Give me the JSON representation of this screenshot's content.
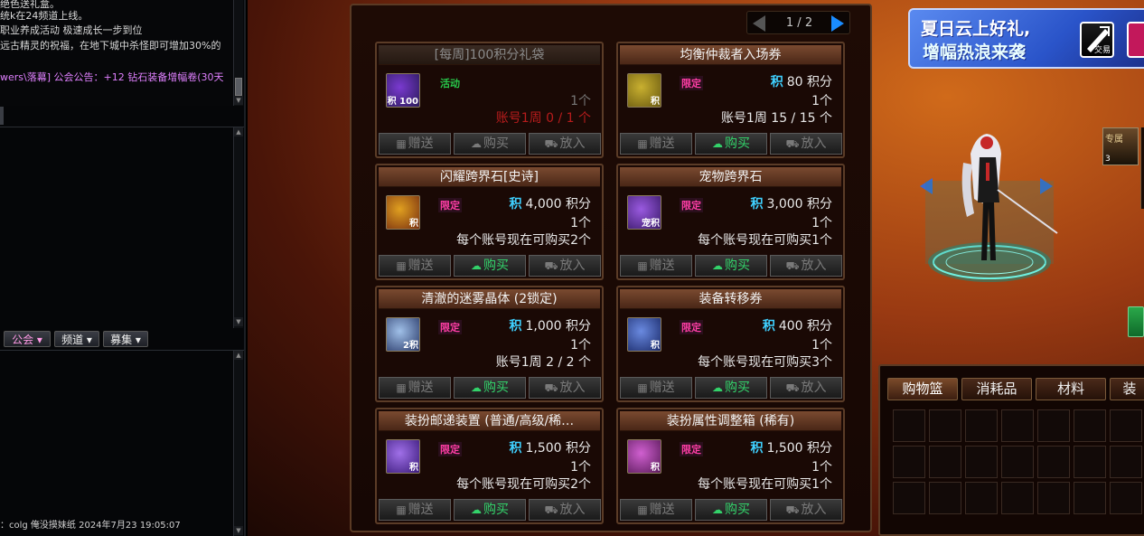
{
  "chat": {
    "top_lines": [
      "绝色送礼盒。",
      "        统k在24频道上线。",
      "职业养成活动 极速成长一步到位",
      "远古精灵的祝福，在地下城中杀怪即可增加30%的"
    ],
    "guild_line": "wers\\落幕] 公会公告：+12 钻石装备增幅卷(30天",
    "tabs": [
      "公会",
      "频道",
      "募集"
    ],
    "last_line": "：colg 俺没摸妹纸 2024年7月23 19:05:07"
  },
  "shop": {
    "pager": "1 / 2",
    "items": [
      {
        "title": "[每周]100积分礼袋",
        "icon": "积\n100",
        "tag": "活动",
        "price": "",
        "qty": "1个",
        "limit": "账号1周 0 / 1 个",
        "buttons": [
          "赠送",
          "购买",
          "放入"
        ]
      },
      {
        "title": "均衡仲裁者入场券",
        "icon": "积",
        "tag": "限定",
        "price": "80 积分",
        "qty": "1个",
        "limit": "账号1周 15 / 15 个",
        "buttons": [
          "赠送",
          "购买",
          "放入"
        ]
      },
      {
        "title": "闪耀跨界石[史诗]",
        "icon": "积",
        "tag": "限定",
        "price": "4,000 积分",
        "qty": "1个",
        "limit": "每个账号现在可购买2个",
        "buttons": [
          "赠送",
          "购买",
          "放入"
        ]
      },
      {
        "title": "宠物跨界石",
        "icon": "宠积",
        "tag": "限定",
        "price": "3,000 积分",
        "qty": "1个",
        "limit": "每个账号现在可购买1个",
        "buttons": [
          "赠送",
          "购买",
          "放入"
        ]
      },
      {
        "title": "清澈的迷雾晶体 (2锁定)",
        "icon": "2积",
        "tag": "限定",
        "price": "1,000 积分",
        "qty": "1个",
        "limit": "账号1周 2 / 2 个",
        "buttons": [
          "赠送",
          "购买",
          "放入"
        ]
      },
      {
        "title": "装备转移券",
        "icon": "积",
        "tag": "限定",
        "price": "400 积分",
        "qty": "1个",
        "limit": "每个账号现在可购买3个",
        "buttons": [
          "赠送",
          "购买",
          "放入"
        ]
      },
      {
        "title": "装扮邮递装置 (普通/高级/稀…",
        "icon": "积",
        "tag": "限定",
        "price": "1,500 积分",
        "qty": "1个",
        "limit": "每个账号现在可购买2个",
        "buttons": [
          "赠送",
          "购买",
          "放入"
        ]
      },
      {
        "title": "装扮属性调整箱 (稀有)",
        "icon": "积",
        "tag": "限定",
        "price": "1,500 积分",
        "qty": "1个",
        "limit": "每个账号现在可购买1个",
        "buttons": [
          "赠送",
          "购买",
          "放入"
        ]
      }
    ],
    "points_glyph": "积"
  },
  "banner": {
    "line1": "夏日云上好礼,",
    "line2": "增幅热浪来袭",
    "trade_label": "交易"
  },
  "side_icon": {
    "text": "专属",
    "count": "3"
  },
  "inventory": {
    "tabs": [
      "购物篮",
      "消耗品",
      "材料",
      "装"
    ]
  },
  "colors": {
    "limited_tag": "#ff3ea6",
    "activity_tag": "#28c64a",
    "points_glyph": "#3fd0ff",
    "buy_button": "#33d26a",
    "pager_next": "#1a8cff"
  }
}
